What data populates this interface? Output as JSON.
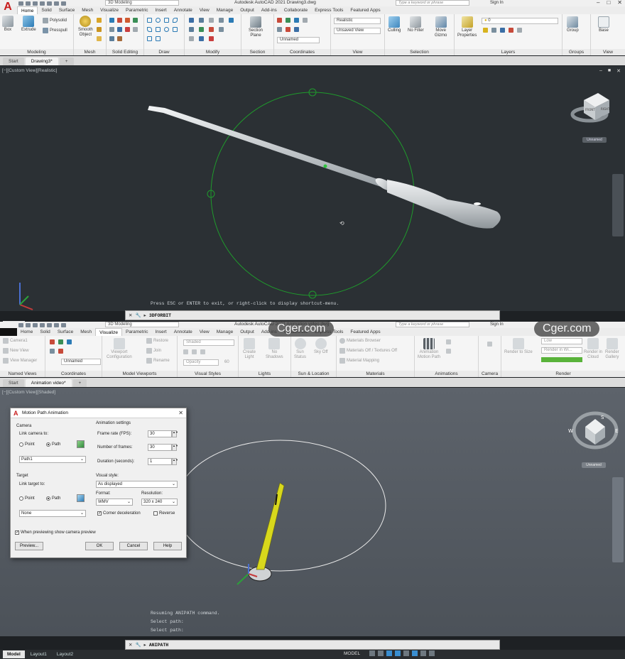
{
  "top": {
    "workspace": "3D Modeling",
    "app_title": "Autodesk AutoCAD 2021    Drawing3.dwg",
    "search_placeholder": "Type a keyword or phrase",
    "sign_in": "Sign In",
    "tabs": [
      "Home",
      "Solid",
      "Surface",
      "Mesh",
      "Visualize",
      "Parametric",
      "Insert",
      "Annotate",
      "View",
      "Manage",
      "Output",
      "Add-ins",
      "Collaborate",
      "Express Tools",
      "Featured Apps"
    ],
    "active_tab": "Home",
    "groups": {
      "modeling": "Modeling",
      "mesh": "Mesh",
      "solid_editing": "Solid Editing",
      "draw": "Draw",
      "modify": "Modify",
      "section": "Section",
      "coordinates": "Coordinates",
      "view": "View",
      "selection": "Selection",
      "layers": "Layers",
      "groups": "Groups",
      "view2": "View"
    },
    "tools": {
      "box": "Box",
      "extrude": "Extrude",
      "polysolid": "Polysolid",
      "presspull": "Presspull",
      "smooth_object_1": "Smooth",
      "smooth_object_2": "Object",
      "section_plane_1": "Section",
      "section_plane_2": "Plane",
      "culling": "Culling",
      "no_filter": "No Filter",
      "move_gizmo_1": "Move",
      "move_gizmo_2": "Gizmo",
      "layer_properties_1": "Layer",
      "layer_properties_2": "Properties",
      "group": "Group",
      "base": "Base",
      "visual_style": "Realistic",
      "saved_view": "Unsaved View",
      "ucs_name": "Unnamed",
      "layer_value": "0"
    },
    "file_tabs": [
      "Start",
      "Drawing3*"
    ],
    "viewport_label": "[−][Custom View][Realistic]",
    "viewcube_label": "Unnamed",
    "command_prompt": "Press ESC or ENTER to exit, or right-click to display shortcut-menu.",
    "command": "3DFORBIT"
  },
  "bottom": {
    "workspace": "3D Modeling",
    "app_title": "Autodesk AutoCAD 2021    Animation video.dwg",
    "search_placeholder": "Type a keyword or phrase",
    "sign_in": "Sign In",
    "tabs": [
      "Home",
      "Solid",
      "Surface",
      "Mesh",
      "Visualize",
      "Parametric",
      "Insert",
      "Annotate",
      "View",
      "Manage",
      "Output",
      "Add-ins",
      "Collaborate",
      "Express Tools",
      "Featured Apps"
    ],
    "active_tab": "Visualize",
    "groups": {
      "named_views": "Named Views",
      "coordinates": "Coordinates",
      "model_viewports": "Model Viewports",
      "visual_styles": "Visual Styles",
      "lights": "Lights",
      "sun_location": "Sun & Location",
      "materials": "Materials",
      "animations": "Animations",
      "camera": "Camera",
      "render": "Render"
    },
    "tools": {
      "camera1": "Camera1",
      "new_view": "New View",
      "view_manager": "View Manager",
      "ucs_name": "Unnamed",
      "viewport_configuration_1": "Viewport",
      "viewport_configuration_2": "Configuration",
      "restore": "Restore",
      "join": "Join",
      "rename": "Rename",
      "visual_style": "Shaded",
      "opacity": "Opacity",
      "opacity_value": "60",
      "create_light_1": "Create",
      "create_light_2": "Light",
      "no_shadows_1": "No",
      "no_shadows_2": "Shadows",
      "sun_status_1": "Sun",
      "sun_status_2": "Status",
      "sky_off_1": "Sky Off",
      "materials_browser": "Materials Browser",
      "materials_off": "Materials Off / Textures Off",
      "material_mapping": "Material Mapping",
      "animate_motion_path_1": "Animation",
      "animate_motion_path_2": "Motion Path",
      "render_to_size": "Render to Size",
      "render_quality": "Low",
      "render_in": "Render in Wi...",
      "render_in_cloud_1": "Render in",
      "render_in_cloud_2": "Cloud",
      "render_gallery_1": "Render",
      "render_gallery_2": "Gallery"
    },
    "file_tabs": [
      "Start",
      "Animation video*"
    ],
    "viewport_label": "[−][Custom View][Shaded]",
    "viewcube_label": "Unnamed",
    "command_history": [
      "Resuming ANIPATH command.",
      "Select path:",
      "Select path:"
    ],
    "command": "ANIPATH",
    "status_model": "MODEL"
  },
  "layout_tabs": [
    "Model",
    "Layout1",
    "Layout2"
  ],
  "watermark": "Cger.com",
  "dialog": {
    "title": "Motion Path Animation",
    "camera_header": "Camera",
    "link_camera_to": "Link camera to:",
    "point": "Point",
    "path": "Path",
    "camera_path_value": "Path1",
    "target_header": "Target",
    "link_target_to": "Link target to:",
    "target_value": "None",
    "animation_settings": "Animation settings",
    "frame_rate_label": "Frame rate (FPS):",
    "frame_rate": "30",
    "num_frames_label": "Number of frames:",
    "num_frames": "30",
    "duration_label": "Duration (seconds):",
    "duration": "1",
    "visual_style_label": "Visual style:",
    "visual_style": "As displayed",
    "format_label": "Format:",
    "format": "WMV",
    "resolution_label": "Resolution:",
    "resolution": "320 x 240",
    "corner_deceleration": "Corner deceleration",
    "reverse": "Reverse",
    "preview_check": "When previewing show camera preview",
    "preview_btn": "Preview...",
    "ok_btn": "OK",
    "cancel_btn": "Cancel",
    "help_btn": "Help"
  },
  "colors": {
    "viewport_top": "#2b3034",
    "viewport_bottom": "#5a6068",
    "orbit_green": "#1f9a2c",
    "path_white": "#e9e9e9",
    "camera_yellow": "#d8d81c",
    "autocad_red": "#c81d1d"
  }
}
